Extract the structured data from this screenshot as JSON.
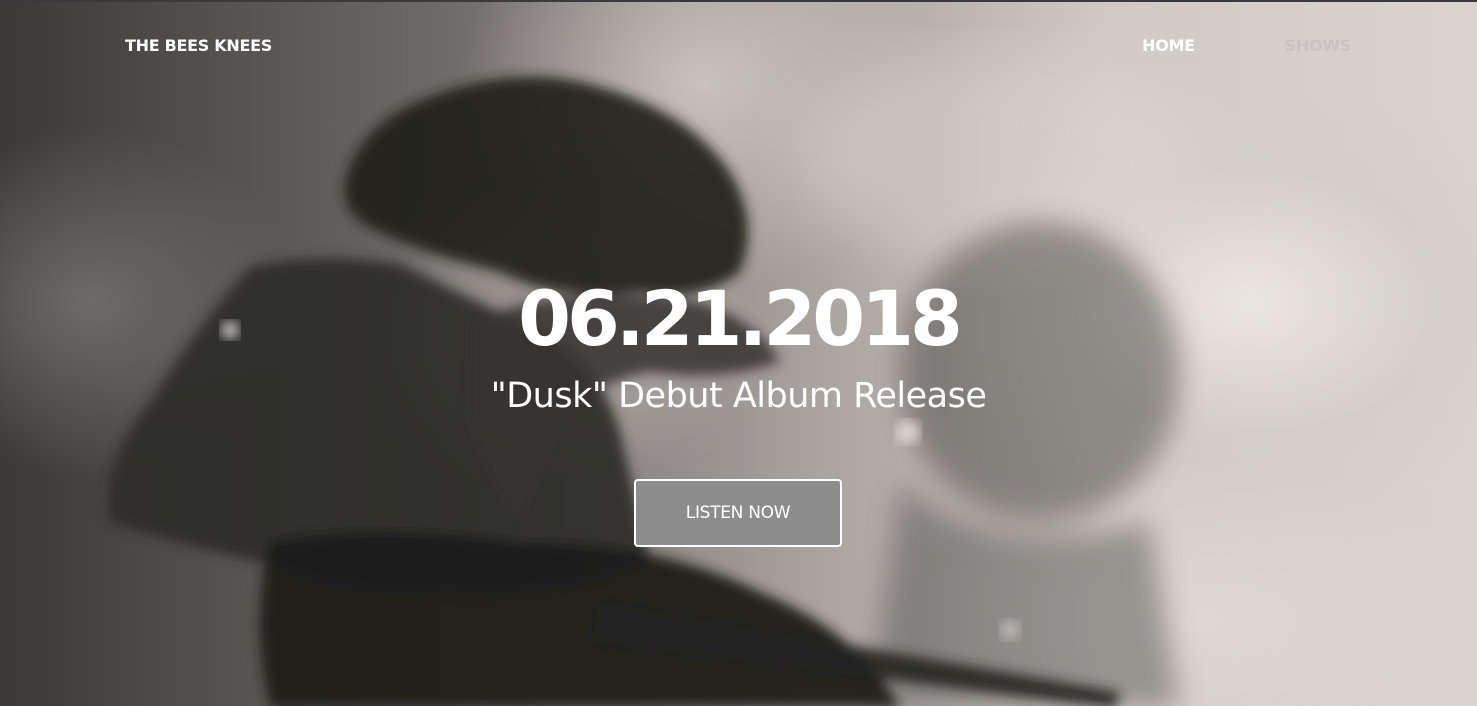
{
  "colors": {
    "text_primary": "#ffffff",
    "nav_inactive": "#c8c4c1",
    "button_fill": "#8d8d8d",
    "button_border": "#ffffff"
  },
  "nav": {
    "brand": "THE BEES KNEES",
    "links": [
      {
        "label": "HOME",
        "active": true
      },
      {
        "label": "SHOWS",
        "active": false
      }
    ]
  },
  "hero": {
    "background_image": "grayscale-concert-guitarist-photo",
    "date": "06.21.2018",
    "subtitle": "\"Dusk\" Debut Album Release",
    "cta_label": "LISTEN NOW"
  }
}
